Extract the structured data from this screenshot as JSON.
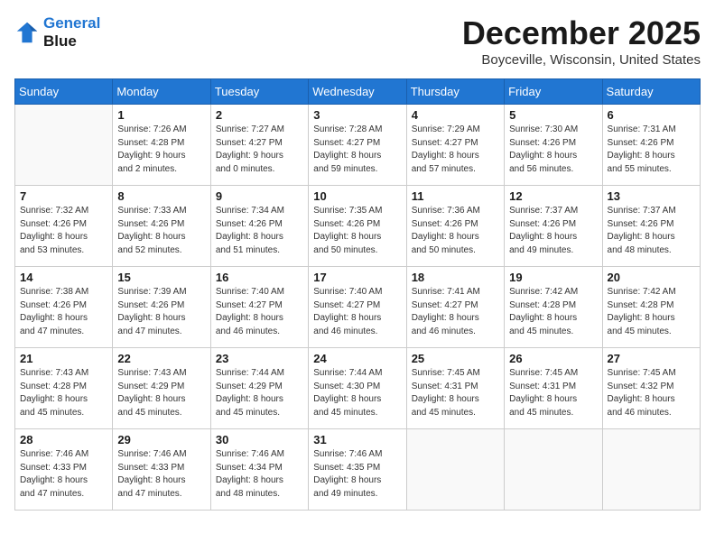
{
  "header": {
    "logo_line1": "General",
    "logo_line2": "Blue",
    "month_title": "December 2025",
    "location": "Boyceville, Wisconsin, United States"
  },
  "weekdays": [
    "Sunday",
    "Monday",
    "Tuesday",
    "Wednesday",
    "Thursday",
    "Friday",
    "Saturday"
  ],
  "weeks": [
    [
      {
        "day": "",
        "info": ""
      },
      {
        "day": "1",
        "info": "Sunrise: 7:26 AM\nSunset: 4:28 PM\nDaylight: 9 hours\nand 2 minutes."
      },
      {
        "day": "2",
        "info": "Sunrise: 7:27 AM\nSunset: 4:27 PM\nDaylight: 9 hours\nand 0 minutes."
      },
      {
        "day": "3",
        "info": "Sunrise: 7:28 AM\nSunset: 4:27 PM\nDaylight: 8 hours\nand 59 minutes."
      },
      {
        "day": "4",
        "info": "Sunrise: 7:29 AM\nSunset: 4:27 PM\nDaylight: 8 hours\nand 57 minutes."
      },
      {
        "day": "5",
        "info": "Sunrise: 7:30 AM\nSunset: 4:26 PM\nDaylight: 8 hours\nand 56 minutes."
      },
      {
        "day": "6",
        "info": "Sunrise: 7:31 AM\nSunset: 4:26 PM\nDaylight: 8 hours\nand 55 minutes."
      }
    ],
    [
      {
        "day": "7",
        "info": "Sunrise: 7:32 AM\nSunset: 4:26 PM\nDaylight: 8 hours\nand 53 minutes."
      },
      {
        "day": "8",
        "info": "Sunrise: 7:33 AM\nSunset: 4:26 PM\nDaylight: 8 hours\nand 52 minutes."
      },
      {
        "day": "9",
        "info": "Sunrise: 7:34 AM\nSunset: 4:26 PM\nDaylight: 8 hours\nand 51 minutes."
      },
      {
        "day": "10",
        "info": "Sunrise: 7:35 AM\nSunset: 4:26 PM\nDaylight: 8 hours\nand 50 minutes."
      },
      {
        "day": "11",
        "info": "Sunrise: 7:36 AM\nSunset: 4:26 PM\nDaylight: 8 hours\nand 50 minutes."
      },
      {
        "day": "12",
        "info": "Sunrise: 7:37 AM\nSunset: 4:26 PM\nDaylight: 8 hours\nand 49 minutes."
      },
      {
        "day": "13",
        "info": "Sunrise: 7:37 AM\nSunset: 4:26 PM\nDaylight: 8 hours\nand 48 minutes."
      }
    ],
    [
      {
        "day": "14",
        "info": "Sunrise: 7:38 AM\nSunset: 4:26 PM\nDaylight: 8 hours\nand 47 minutes."
      },
      {
        "day": "15",
        "info": "Sunrise: 7:39 AM\nSunset: 4:26 PM\nDaylight: 8 hours\nand 47 minutes."
      },
      {
        "day": "16",
        "info": "Sunrise: 7:40 AM\nSunset: 4:27 PM\nDaylight: 8 hours\nand 46 minutes."
      },
      {
        "day": "17",
        "info": "Sunrise: 7:40 AM\nSunset: 4:27 PM\nDaylight: 8 hours\nand 46 minutes."
      },
      {
        "day": "18",
        "info": "Sunrise: 7:41 AM\nSunset: 4:27 PM\nDaylight: 8 hours\nand 46 minutes."
      },
      {
        "day": "19",
        "info": "Sunrise: 7:42 AM\nSunset: 4:28 PM\nDaylight: 8 hours\nand 45 minutes."
      },
      {
        "day": "20",
        "info": "Sunrise: 7:42 AM\nSunset: 4:28 PM\nDaylight: 8 hours\nand 45 minutes."
      }
    ],
    [
      {
        "day": "21",
        "info": "Sunrise: 7:43 AM\nSunset: 4:28 PM\nDaylight: 8 hours\nand 45 minutes."
      },
      {
        "day": "22",
        "info": "Sunrise: 7:43 AM\nSunset: 4:29 PM\nDaylight: 8 hours\nand 45 minutes."
      },
      {
        "day": "23",
        "info": "Sunrise: 7:44 AM\nSunset: 4:29 PM\nDaylight: 8 hours\nand 45 minutes."
      },
      {
        "day": "24",
        "info": "Sunrise: 7:44 AM\nSunset: 4:30 PM\nDaylight: 8 hours\nand 45 minutes."
      },
      {
        "day": "25",
        "info": "Sunrise: 7:45 AM\nSunset: 4:31 PM\nDaylight: 8 hours\nand 45 minutes."
      },
      {
        "day": "26",
        "info": "Sunrise: 7:45 AM\nSunset: 4:31 PM\nDaylight: 8 hours\nand 45 minutes."
      },
      {
        "day": "27",
        "info": "Sunrise: 7:45 AM\nSunset: 4:32 PM\nDaylight: 8 hours\nand 46 minutes."
      }
    ],
    [
      {
        "day": "28",
        "info": "Sunrise: 7:46 AM\nSunset: 4:33 PM\nDaylight: 8 hours\nand 47 minutes."
      },
      {
        "day": "29",
        "info": "Sunrise: 7:46 AM\nSunset: 4:33 PM\nDaylight: 8 hours\nand 47 minutes."
      },
      {
        "day": "30",
        "info": "Sunrise: 7:46 AM\nSunset: 4:34 PM\nDaylight: 8 hours\nand 48 minutes."
      },
      {
        "day": "31",
        "info": "Sunrise: 7:46 AM\nSunset: 4:35 PM\nDaylight: 8 hours\nand 49 minutes."
      },
      {
        "day": "",
        "info": ""
      },
      {
        "day": "",
        "info": ""
      },
      {
        "day": "",
        "info": ""
      }
    ]
  ]
}
